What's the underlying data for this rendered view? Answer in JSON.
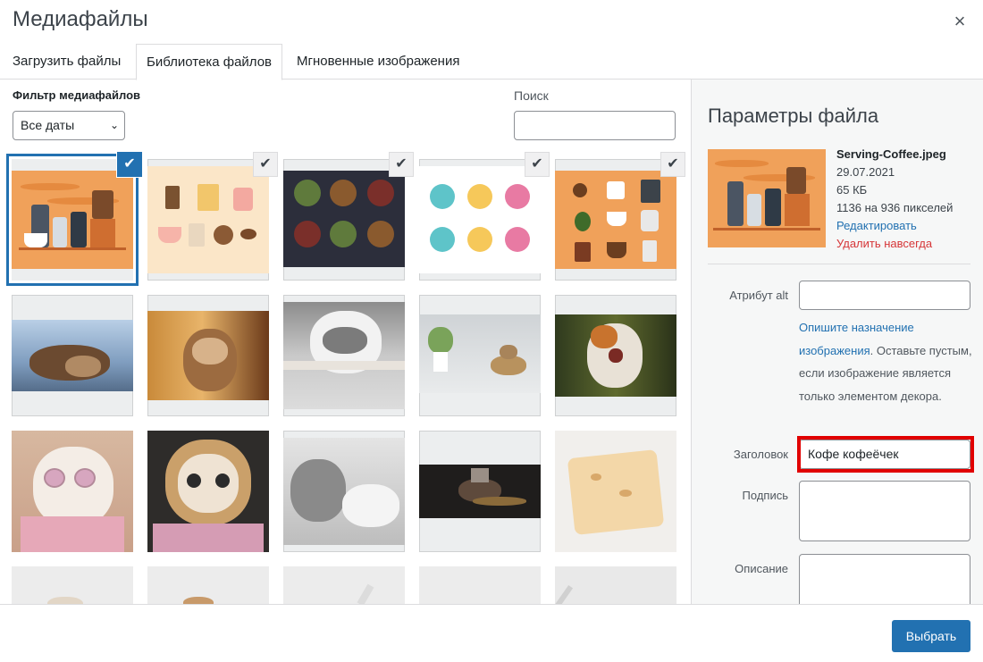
{
  "modal": {
    "title": "Медиафайлы",
    "close_icon": "×"
  },
  "tabs": [
    {
      "label": "Загрузить файлы",
      "active": false
    },
    {
      "label": "Библиотека файлов",
      "active": true
    },
    {
      "label": "Мгновенные изображения",
      "active": false
    }
  ],
  "filter": {
    "label": "Фильтр медиафайлов",
    "date_value": "Все даты",
    "chevron": "⌄"
  },
  "search": {
    "label": "Поиск",
    "value": ""
  },
  "check_glyph": "✔",
  "sidebar": {
    "title": "Параметры файла",
    "file": {
      "name": "Serving-Coffee.jpeg",
      "date": "29.07.2021",
      "size": "65 КБ",
      "dimensions": "1136 на 936 пикселей",
      "edit_label": "Редактировать",
      "delete_label": "Удалить навсегда"
    },
    "alt": {
      "label": "Атрибут alt",
      "value": "",
      "help_link": "Опишите назначение изображения",
      "help_rest": ". Оставьте пустым, если изображение является только элементом декора."
    },
    "caption_title": {
      "label": "Заголовок",
      "value": "Кофе кофеёчек"
    },
    "caption": {
      "label": "Подпись",
      "value": ""
    },
    "description": {
      "label": "Описание",
      "value": ""
    }
  },
  "footer": {
    "select_label": "Выбрать"
  },
  "colors": {
    "accent": "#2271b1",
    "danger": "#d63638",
    "highlight": "#e10000"
  }
}
